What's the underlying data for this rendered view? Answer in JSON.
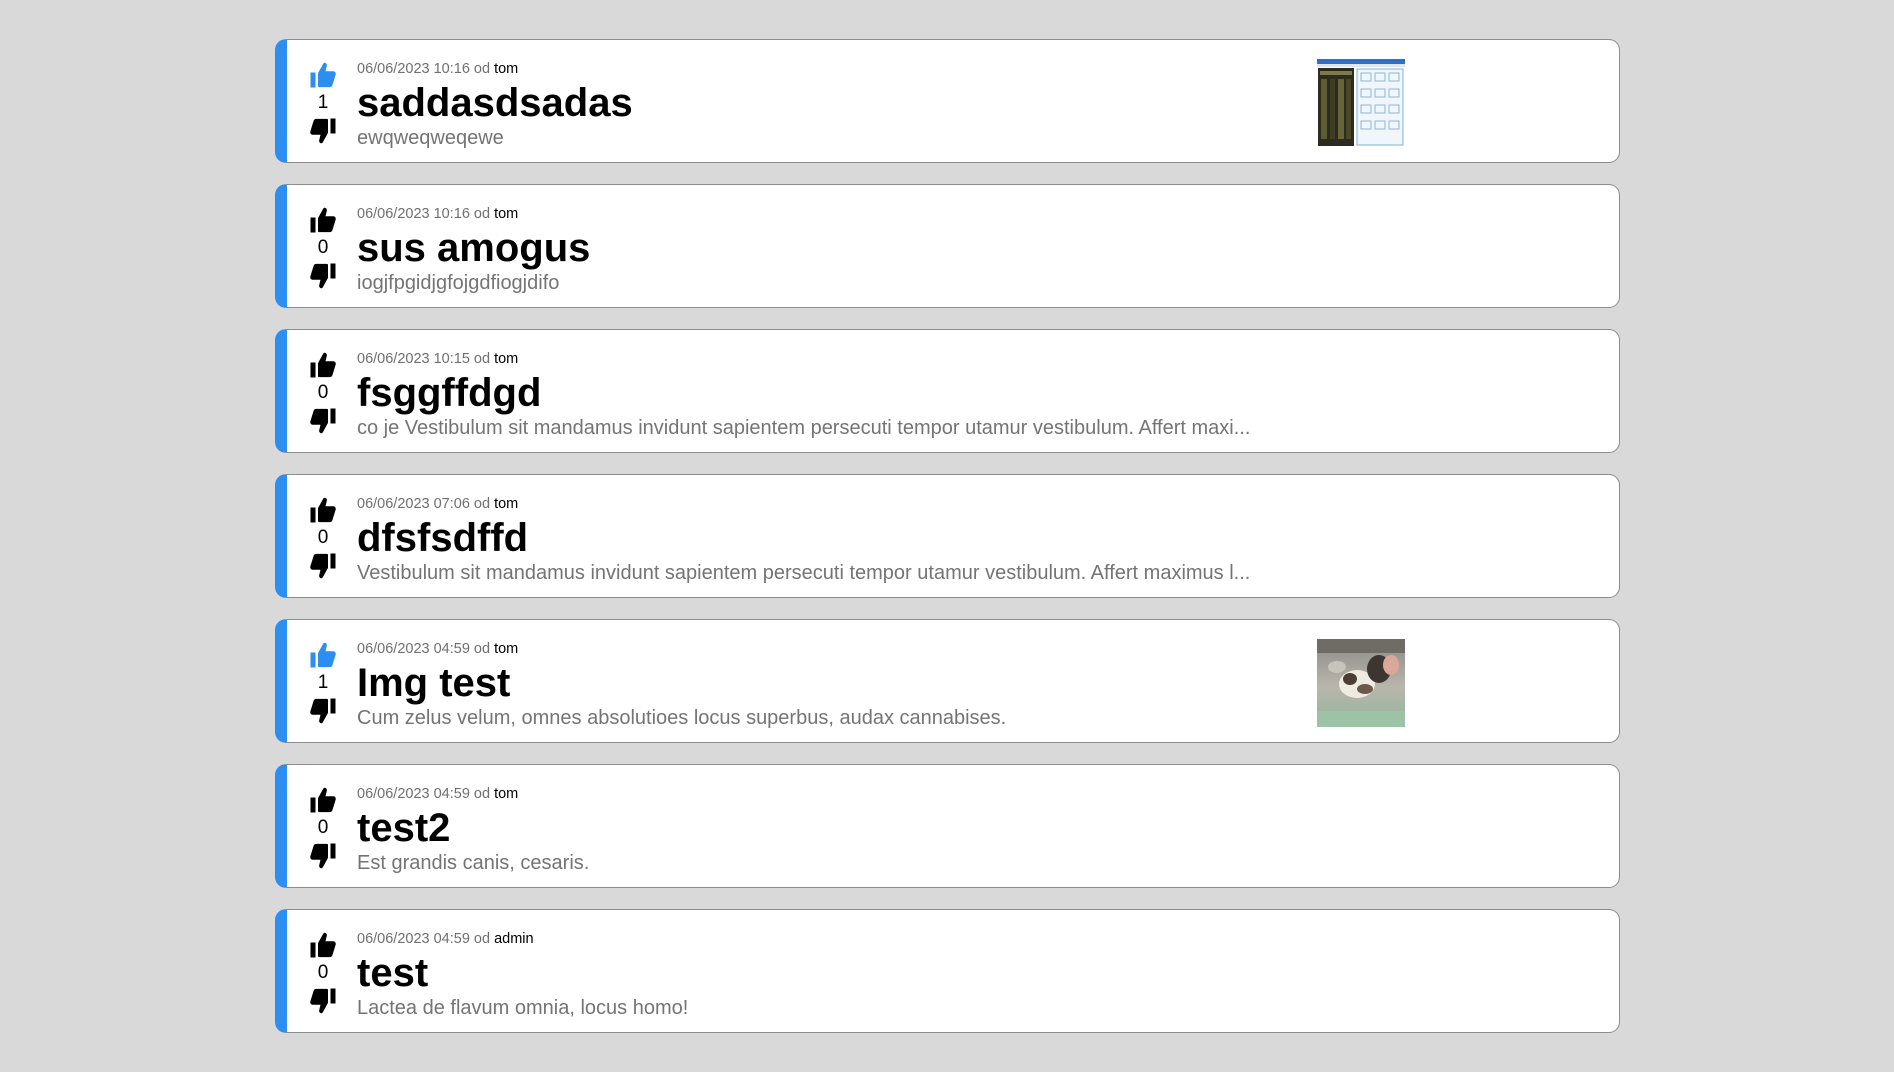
{
  "posts": [
    {
      "votes": "1",
      "upvoted": true,
      "date": "06/06/2023 10:16",
      "od": "od",
      "author": "tom",
      "title": "saddasdsadas",
      "excerpt": "ewqweqweqewe",
      "has_image": true,
      "image_kind": "screenshot-thumbnail"
    },
    {
      "votes": "0",
      "upvoted": false,
      "date": "06/06/2023 10:16",
      "od": "od",
      "author": "tom",
      "title": "sus amogus",
      "excerpt": "iogjfpgidjgfojgdfiogjdifo",
      "has_image": false
    },
    {
      "votes": "0",
      "upvoted": false,
      "date": "06/06/2023 10:15",
      "od": "od",
      "author": "tom",
      "title": "fsggffdgd",
      "excerpt": "co je Vestibulum sit mandamus invidunt sapientem persecuti tempor utamur vestibulum. Affert maxi...",
      "has_image": false
    },
    {
      "votes": "0",
      "upvoted": false,
      "date": "06/06/2023 07:06",
      "od": "od",
      "author": "tom",
      "title": "dfsfsdffd",
      "excerpt": "Vestibulum sit mandamus invidunt sapientem persecuti tempor utamur vestibulum. Affert maximus l...",
      "has_image": false
    },
    {
      "votes": "1",
      "upvoted": true,
      "date": "06/06/2023 04:59",
      "od": "od",
      "author": "tom",
      "title": "Img test",
      "excerpt": "Cum zelus velum, omnes absolutioes locus superbus, audax cannabises.",
      "has_image": true,
      "image_kind": "photo-thumbnail"
    },
    {
      "votes": "0",
      "upvoted": false,
      "date": "06/06/2023 04:59",
      "od": "od",
      "author": "tom",
      "title": "test2",
      "excerpt": "Est grandis canis, cesaris.",
      "has_image": false
    },
    {
      "votes": "0",
      "upvoted": false,
      "date": "06/06/2023 04:59",
      "od": "od",
      "author": "admin",
      "title": "test",
      "excerpt": "Lactea de flavum omnia, locus homo!",
      "has_image": false
    }
  ],
  "icons": {
    "upvote": "thumbs-up-icon",
    "downvote": "thumbs-down-icon"
  },
  "colors": {
    "accent": "#2b8ef0",
    "background": "#d9d9d9",
    "card": "#ffffff",
    "muted_text": "#747474"
  }
}
